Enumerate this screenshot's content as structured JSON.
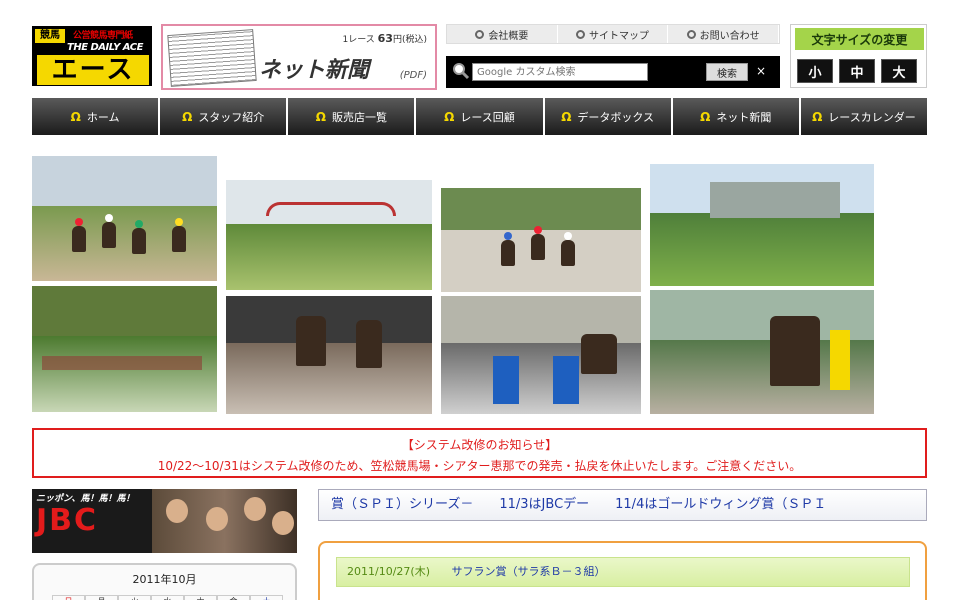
{
  "logo": {
    "kind": "競馬",
    "category": "公営競馬専門紙",
    "english": "THE DAILY ACE",
    "japanese": "エース"
  },
  "net_paper": {
    "price_prefix": "1レース",
    "price_value": "63",
    "price_suffix": "円(税込)",
    "title": "ネット新聞",
    "format": "(PDF)"
  },
  "top_links": [
    {
      "label": "会社概要"
    },
    {
      "label": "サイトマップ"
    },
    {
      "label": "お問い合わせ"
    }
  ],
  "search": {
    "placeholder": "Google カスタム検索",
    "button": "検索",
    "clear": "×"
  },
  "font_size": {
    "title": "文字サイズの変更",
    "small": "小",
    "medium": "中",
    "large": "大"
  },
  "main_nav": [
    {
      "label": "ホーム"
    },
    {
      "label": "スタッフ紹介"
    },
    {
      "label": "販売店一覧"
    },
    {
      "label": "レース回顧"
    },
    {
      "label": "データボックス"
    },
    {
      "label": "ネット新聞"
    },
    {
      "label": "レースカレンダー"
    }
  ],
  "notice": {
    "title": "【システム改修のお知らせ】",
    "body": "10/22～10/31はシステム改修のため、笠松競馬場・シアター恵那での発売・払戻を休止いたします。ご注意ください。"
  },
  "jbc_banner": {
    "tagline": "ニッポン、馬！馬！馬！",
    "logo": "JBC"
  },
  "calendar": {
    "month": "2011年10月",
    "weekdays": [
      "日",
      "月",
      "火",
      "水",
      "木",
      "金",
      "土"
    ]
  },
  "marquee": {
    "text": "賞（ＳＰＩ）シリーズ－　　11/3はJBCデー　　11/4はゴールドウィング賞（ＳＰＩ"
  },
  "race_list": [
    {
      "date": "2011/10/27(木)",
      "race": "サフラン賞（サラ系Ｂ－３組）"
    }
  ],
  "colors": {
    "brand_yellow": "#f5d800",
    "nav_dark": "#1b1b1b",
    "notice_red": "#e01d1d",
    "fontsize_green": "#a4d44a",
    "link_blue": "#1f3aa7",
    "racebox_orange": "#f0a040"
  }
}
